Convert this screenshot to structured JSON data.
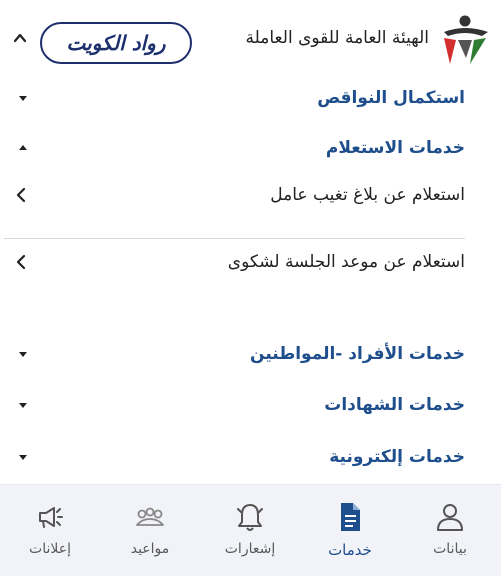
{
  "header": {
    "org_title": "الهيئة العامة للقوى العاملة",
    "brand_text": "رواد الكويت"
  },
  "menu": {
    "incomplete": "استكمال النواقص",
    "inquiry_services": "خدمات الاستعلام",
    "inquiry_absence": "استعلام عن بلاغ تغيب عامل",
    "inquiry_session": "استعلام عن موعد الجلسة لشكوى",
    "individual_services": "خدمات الأفراد -المواطنين",
    "certificate_services": "خدمات الشهادات",
    "electronic_services": "خدمات إلكترونية"
  },
  "nav": {
    "data": "بيانات",
    "services": "خدمات",
    "notifications": "إشعارات",
    "appointments": "مواعيد",
    "announcements": "إعلانات"
  },
  "colors": {
    "accent": "#1f4e8c",
    "brand_navy": "#1e2f6e",
    "nav_background": "#f1f3f8"
  }
}
